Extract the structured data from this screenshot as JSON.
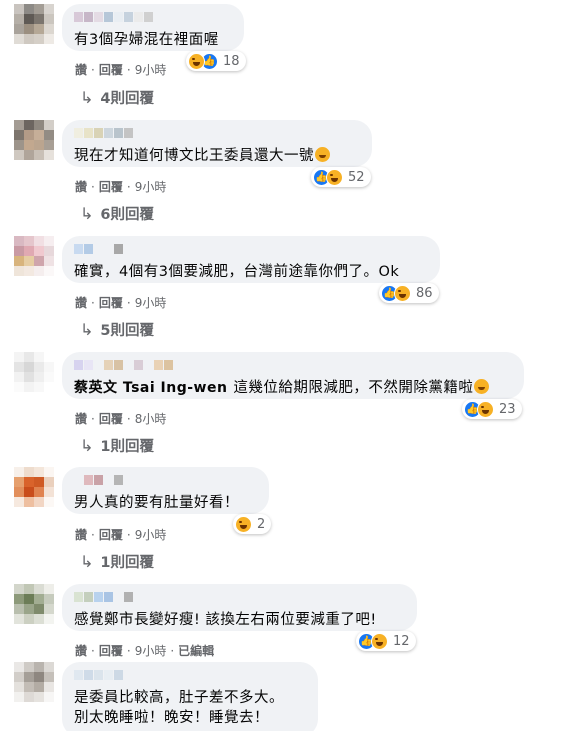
{
  "comments": [
    {
      "text": "有3個孕婦混在裡面喔",
      "reactions": [
        "haha",
        "like"
      ],
      "reaction_count": "18",
      "actions": [
        "讚",
        "回覆",
        "9小時"
      ],
      "replies_label": "4則回覆"
    },
    {
      "text": "現在才知道何博文比王委員還大一號",
      "reactions": [
        "like",
        "haha"
      ],
      "reaction_count": "52",
      "actions": [
        "讚",
        "回覆",
        "9小時"
      ],
      "replies_label": "6則回覆"
    },
    {
      "text": "確實，4個有3個要減肥，台灣前途靠你們了。Ok",
      "reactions": [
        "like",
        "haha"
      ],
      "reaction_count": "86",
      "actions": [
        "讚",
        "回覆",
        "9小時"
      ],
      "replies_label": "5則回覆"
    },
    {
      "author": "蔡英文 Tsai Ing-wen",
      "text": "這幾位給期限減肥，不然開除黨籍啦",
      "reactions": [
        "like",
        "haha"
      ],
      "reaction_count": "23",
      "actions": [
        "讚",
        "回覆",
        "8小時"
      ],
      "replies_label": "1則回覆"
    },
    {
      "text": "男人真的要有肚量好看！",
      "reactions": [
        "haha"
      ],
      "reaction_count": "2",
      "actions": [
        "讚",
        "回覆",
        "9小時"
      ],
      "replies_label": "1則回覆"
    },
    {
      "text": "感覺鄭市長變好瘦! 該換左右兩位要減重了吧!",
      "reactions": [
        "like",
        "haha"
      ],
      "reaction_count": "12",
      "actions": [
        "讚",
        "回覆",
        "9小時",
        "已編輯"
      ]
    },
    {
      "text_lines": [
        "是委員比較高，肚子差不多大。",
        "別太晚睡啦！晚安！睡覺去！"
      ]
    }
  ],
  "colors": {
    "bubble": "#f0f2f5",
    "secondary_text": "#65676b",
    "like_blue": "#1877f2",
    "haha_yellow": "#f7b125"
  }
}
